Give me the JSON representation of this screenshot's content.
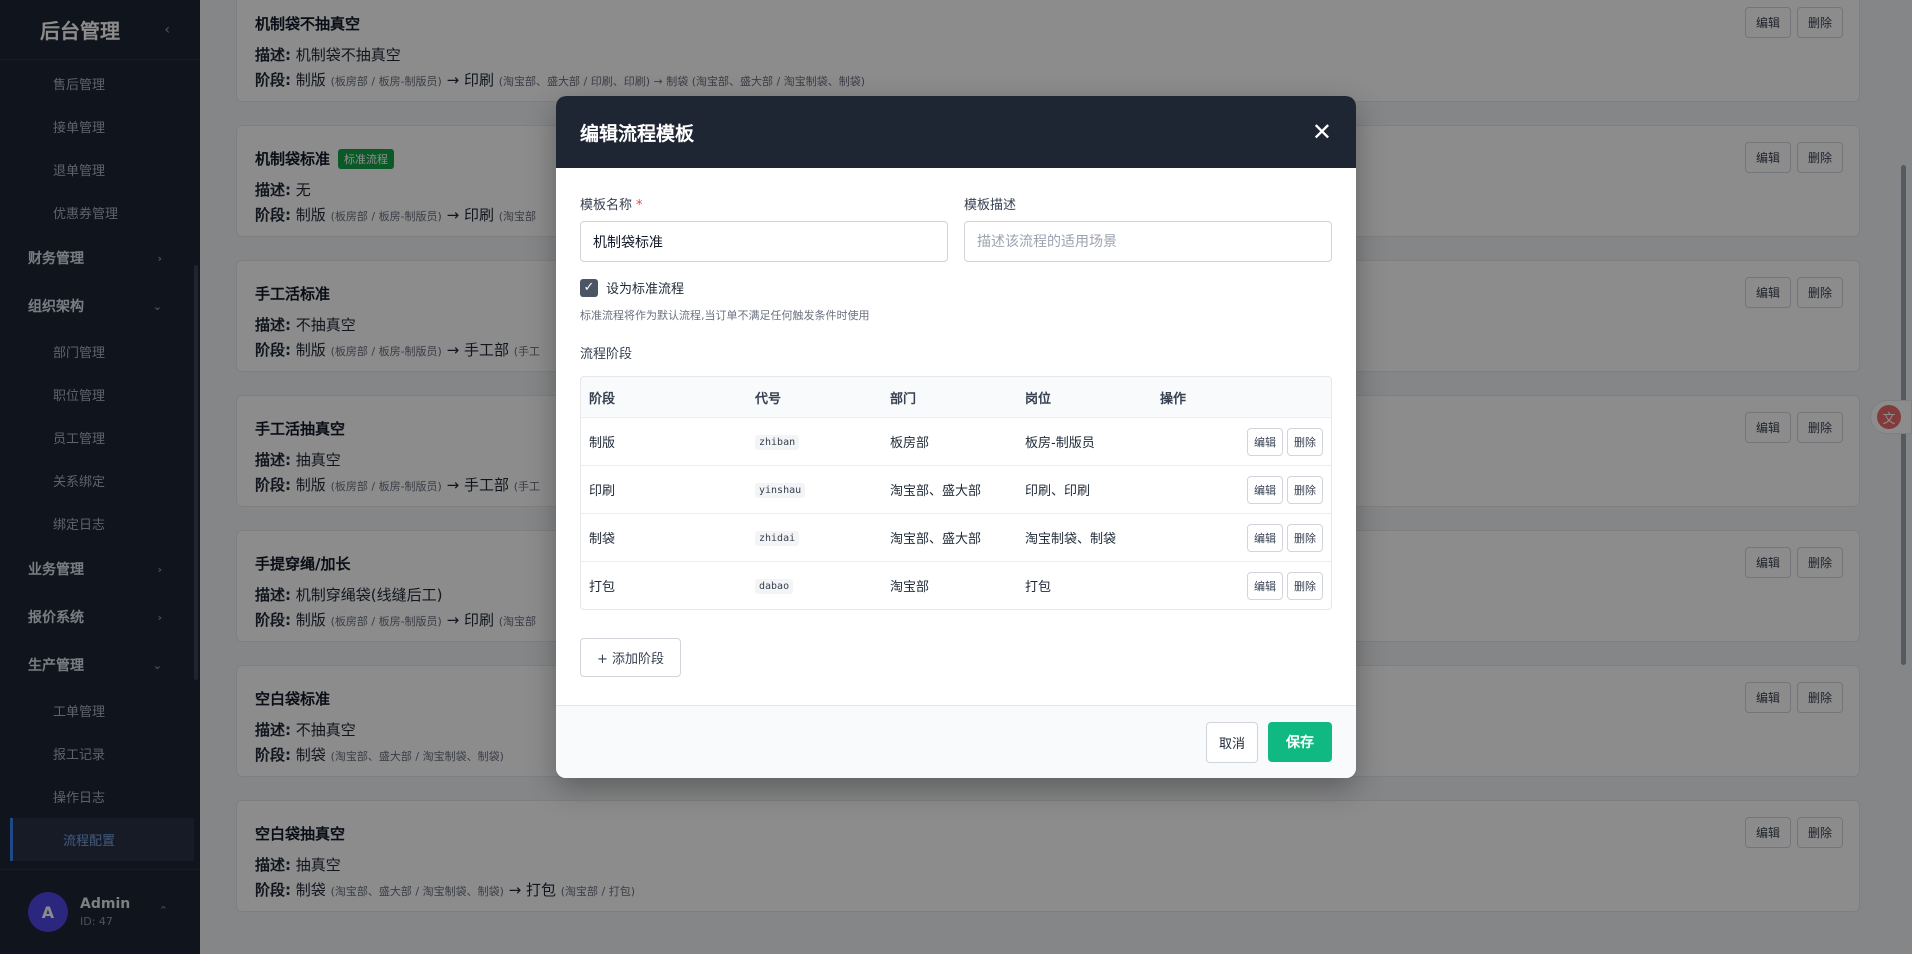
{
  "sidebar": {
    "brand": "后台管理",
    "collapse_icon": "‹",
    "items": [
      {
        "type": "sub",
        "label": "售后管理"
      },
      {
        "type": "sub",
        "label": "接单管理"
      },
      {
        "type": "sub",
        "label": "退单管理"
      },
      {
        "type": "sub",
        "label": "优惠券管理"
      },
      {
        "type": "group",
        "label": "财务管理",
        "chevron": "›"
      },
      {
        "type": "group",
        "label": "组织架构",
        "chevron": "⌄"
      },
      {
        "type": "sub",
        "label": "部门管理"
      },
      {
        "type": "sub",
        "label": "职位管理"
      },
      {
        "type": "sub",
        "label": "员工管理"
      },
      {
        "type": "sub",
        "label": "关系绑定"
      },
      {
        "type": "sub",
        "label": "绑定日志"
      },
      {
        "type": "group",
        "label": "业务管理",
        "chevron": "›"
      },
      {
        "type": "group",
        "label": "报价系统",
        "chevron": "›"
      },
      {
        "type": "group",
        "label": "生产管理",
        "chevron": "⌄"
      },
      {
        "type": "sub",
        "label": "工单管理"
      },
      {
        "type": "sub",
        "label": "报工记录"
      },
      {
        "type": "sub",
        "label": "操作日志"
      },
      {
        "type": "sub",
        "label": "流程配置",
        "active": true
      }
    ],
    "user": {
      "avatar": "A",
      "name": "Admin",
      "id": "ID: 47"
    }
  },
  "cards": [
    {
      "title": "机制袋不抽真空",
      "desc_label": "描述:",
      "desc": "机制袋不抽真空",
      "stage_label": "阶段:",
      "stages_main": "制版",
      "stages_small": "(板房部 / 板房-制版员)",
      "stages_rest": "→ 印刷",
      "stages_rest_small": "(淘宝部、盛大部 / 印刷、印刷) → 制袋 (淘宝部、盛大部 / 淘宝制袋、制袋)"
    },
    {
      "title": "机制袋标准",
      "badge": "标准流程",
      "desc_label": "描述:",
      "desc": "无",
      "stage_label": "阶段:",
      "stages_main": "制版",
      "stages_small": "(板房部 / 板房-制版员)",
      "stages_rest": "→ 印刷",
      "stages_rest_small": "(淘宝部"
    },
    {
      "title": "手工活标准",
      "desc_label": "描述:",
      "desc": "不抽真空",
      "stage_label": "阶段:",
      "stages_main": "制版",
      "stages_small": "(板房部 / 板房-制版员)",
      "stages_rest": "→ 手工部",
      "stages_rest_small": "(手工"
    },
    {
      "title": "手工活抽真空",
      "desc_label": "描述:",
      "desc": "抽真空",
      "stage_label": "阶段:",
      "stages_main": "制版",
      "stages_small": "(板房部 / 板房-制版员)",
      "stages_rest": "→ 手工部",
      "stages_rest_small": "(手工"
    },
    {
      "title": "手提穿绳/加长",
      "desc_label": "描述:",
      "desc": "机制穿绳袋(线缝后工)",
      "stage_label": "阶段:",
      "stages_main": "制版",
      "stages_small": "(板房部 / 板房-制版员)",
      "stages_rest": "→ 印刷",
      "stages_rest_small": "(淘宝部"
    },
    {
      "title": "空白袋标准",
      "desc_label": "描述:",
      "desc": "不抽真空",
      "stage_label": "阶段:",
      "stages_main": "制袋",
      "stages_small": "(淘宝部、盛大部 / 淘宝制袋、制袋)",
      "stages_rest": "",
      "stages_rest_small": ""
    },
    {
      "title": "空白袋抽真空",
      "desc_label": "描述:",
      "desc": "抽真空",
      "stage_label": "阶段:",
      "stages_main": "制袋",
      "stages_small": "(淘宝部、盛大部 / 淘宝制袋、制袋)",
      "stages_rest": "→ 打包",
      "stages_rest_small": "(淘宝部 / 打包)"
    }
  ],
  "card_actions": {
    "edit": "编辑",
    "delete": "删除"
  },
  "modal": {
    "title": "编辑流程模板",
    "close": "✕",
    "name_label": "模板名称",
    "required_mark": "*",
    "name_value": "机制袋标准",
    "desc_label": "模板描述",
    "desc_placeholder": "描述该流程的适用场景",
    "checkbox_label": "设为标准流程",
    "checkbox_checked": true,
    "hint": "标准流程将作为默认流程,当订单不满足任何触发条件时使用",
    "stages_section": "流程阶段",
    "table_headers": [
      "阶段",
      "代号",
      "部门",
      "岗位",
      "操作"
    ],
    "stages": [
      {
        "stage": "制版",
        "code": "zhiban",
        "dept": "板房部",
        "post": "板房-制版员"
      },
      {
        "stage": "印刷",
        "code": "yinshau",
        "dept": "淘宝部、盛大部",
        "post": "印刷、印刷"
      },
      {
        "stage": "制袋",
        "code": "zhidai",
        "dept": "淘宝部、盛大部",
        "post": "淘宝制袋、制袋"
      },
      {
        "stage": "打包",
        "code": "dabao",
        "dept": "淘宝部",
        "post": "打包"
      }
    ],
    "row_edit": "编辑",
    "row_delete": "删除",
    "add_stage": "+ 添加阶段",
    "cancel": "取消",
    "save": "保存"
  },
  "float_icon": "文"
}
